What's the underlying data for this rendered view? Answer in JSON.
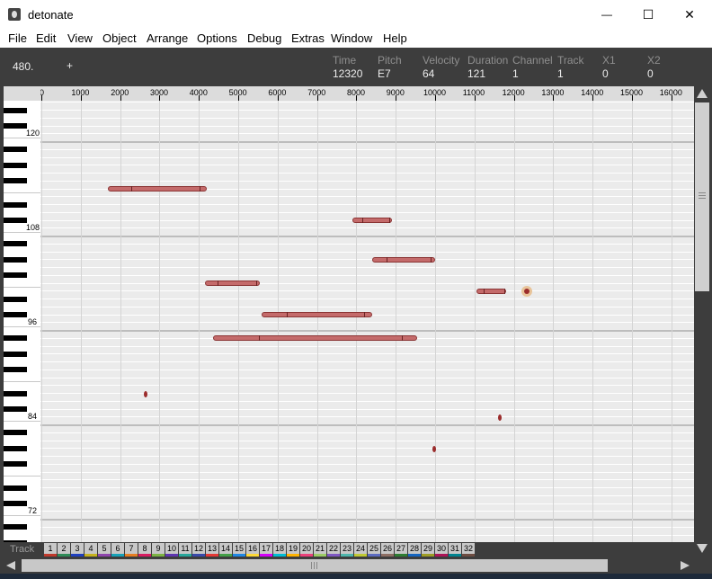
{
  "window": {
    "title": "detonate",
    "minimize_glyph": "—",
    "maximize_glyph": "☐",
    "close_glyph": "✕"
  },
  "menu": {
    "items": [
      {
        "label": "File"
      },
      {
        "label": "Edit"
      },
      {
        "label": "View"
      },
      {
        "label": "Object"
      },
      {
        "label": "Arrange"
      },
      {
        "label": "Options"
      },
      {
        "label": "Debug"
      },
      {
        "label": "Extras"
      },
      {
        "label": "Window"
      },
      {
        "label": "Help"
      }
    ]
  },
  "status": {
    "position": "480.",
    "plus": "+",
    "fields": [
      {
        "label": "Time",
        "value": "12320"
      },
      {
        "label": "Pitch",
        "value": "E7"
      },
      {
        "label": "Velocity",
        "value": "64"
      },
      {
        "label": "Duration",
        "value": "121"
      },
      {
        "label": "Channel",
        "value": "1"
      },
      {
        "label": "Track",
        "value": "1"
      },
      {
        "label": "X1",
        "value": "0"
      },
      {
        "label": "X2",
        "value": "0"
      }
    ]
  },
  "ruler": {
    "ticks": [
      "0",
      "1000",
      "2000",
      "3000",
      "4000",
      "5000",
      "6000",
      "7000",
      "8000",
      "9000",
      "10000",
      "11000",
      "12000",
      "13000",
      "14000",
      "15000",
      "16000"
    ]
  },
  "keyboard": {
    "octave_labels": [
      "120",
      "108",
      "96",
      "84",
      "72"
    ]
  },
  "notes": [
    {
      "start": 1700,
      "end": 4200,
      "pitch": 113
    },
    {
      "start": 7900,
      "end": 8900,
      "pitch": 109
    },
    {
      "start": 8400,
      "end": 10000,
      "pitch": 104
    },
    {
      "start": 4150,
      "end": 5550,
      "pitch": 101
    },
    {
      "start": 11050,
      "end": 11800,
      "pitch": 100
    },
    {
      "start": 5600,
      "end": 8400,
      "pitch": 97
    },
    {
      "start": 4350,
      "end": 9550,
      "pitch": 94
    },
    {
      "start": 2650,
      "end": 2700,
      "pitch": 87
    },
    {
      "start": 11650,
      "end": 11680,
      "pitch": 84
    },
    {
      "start": 9980,
      "end": 10010,
      "pitch": 80
    }
  ],
  "cursor_note": {
    "time": 12320,
    "pitch": 100
  },
  "tracks": {
    "label": "Track",
    "items": [
      {
        "n": "1",
        "color": "#c0392b"
      },
      {
        "n": "2",
        "color": "#2e8b57"
      },
      {
        "n": "3",
        "color": "#1f3fbf"
      },
      {
        "n": "4",
        "color": "#c7b21e"
      },
      {
        "n": "5",
        "color": "#8e44ad"
      },
      {
        "n": "6",
        "color": "#17a2b8"
      },
      {
        "n": "7",
        "color": "#e67e22"
      },
      {
        "n": "8",
        "color": "#d81b60"
      },
      {
        "n": "9",
        "color": "#7cb342"
      },
      {
        "n": "10",
        "color": "#5e35b1"
      },
      {
        "n": "11",
        "color": "#26a69a"
      },
      {
        "n": "12",
        "color": "#3949ab"
      },
      {
        "n": "13",
        "color": "#e53935"
      },
      {
        "n": "14",
        "color": "#43a047"
      },
      {
        "n": "15",
        "color": "#1e88e5"
      },
      {
        "n": "16",
        "color": "#fdd835"
      },
      {
        "n": "17",
        "color": "#d500f9"
      },
      {
        "n": "18",
        "color": "#00bcd4"
      },
      {
        "n": "19",
        "color": "#ffb300"
      },
      {
        "n": "20",
        "color": "#ec407a"
      },
      {
        "n": "21",
        "color": "#9ccc65"
      },
      {
        "n": "22",
        "color": "#7e57c2"
      },
      {
        "n": "23",
        "color": "#4db6ac"
      },
      {
        "n": "24",
        "color": "#c0ca33"
      },
      {
        "n": "25",
        "color": "#5c6bc0"
      },
      {
        "n": "26",
        "color": "#8d6e63"
      },
      {
        "n": "27",
        "color": "#2e7d32"
      },
      {
        "n": "28",
        "color": "#1565c0"
      },
      {
        "n": "29",
        "color": "#9e9d24"
      },
      {
        "n": "30",
        "color": "#ad1457"
      },
      {
        "n": "31",
        "color": "#00838f"
      },
      {
        "n": "32",
        "color": "#6d4c41"
      }
    ]
  }
}
